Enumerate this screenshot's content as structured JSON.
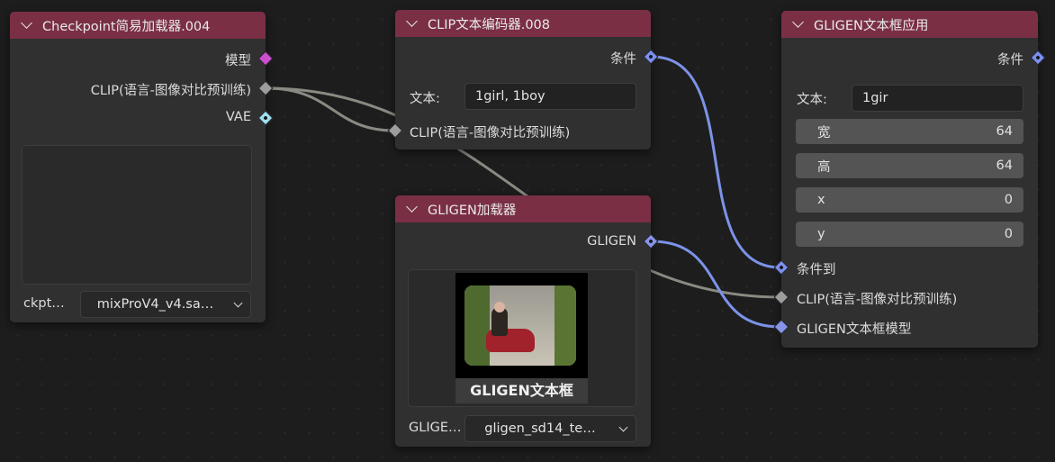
{
  "colors": {
    "header": "#7a2f45",
    "node_body": "#303030",
    "socket_model": "#c94fcf",
    "socket_clip": "#9d9d9d",
    "socket_vae": "#9fe0f2",
    "socket_conditioning": "#7c8ff0",
    "socket_gligen": "#8795e8",
    "wire_clip": "#8a8a82",
    "wire_blue": "#7d92e8"
  },
  "nodes": {
    "checkpoint": {
      "title": "Checkpoint简易加载器.004",
      "out_model": "模型",
      "out_clip": "CLIP(语言-图像对比预训练)",
      "out_vae": "VAE",
      "ckpt_label": "ckpt…",
      "ckpt_value": "mixProV4_v4.sa…"
    },
    "clip_encoder": {
      "title": "CLIP文本编码器.008",
      "out_cond": "条件",
      "text_label": "文本:",
      "text_value": "1girl, 1boy",
      "in_clip": "CLIP(语言-图像对比预训练)"
    },
    "gligen_loader": {
      "title": "GLIGEN加载器",
      "out_gligen": "GLIGEN",
      "preview_caption": "GLIGEN文本框",
      "gligen_label": "GLIGE…",
      "gligen_value": "gligen_sd14_te…"
    },
    "gligen_apply": {
      "title": "GLIGEN文本框应用",
      "out_cond": "条件",
      "text_label": "文本:",
      "text_value": "1gir",
      "width_label": "宽",
      "width_value": "64",
      "height_label": "高",
      "height_value": "64",
      "x_label": "x",
      "x_value": "0",
      "y_label": "y",
      "y_value": "0",
      "in_cond": "条件到",
      "in_clip": "CLIP(语言-图像对比预训练)",
      "in_gligen": "GLIGEN文本框模型"
    }
  }
}
